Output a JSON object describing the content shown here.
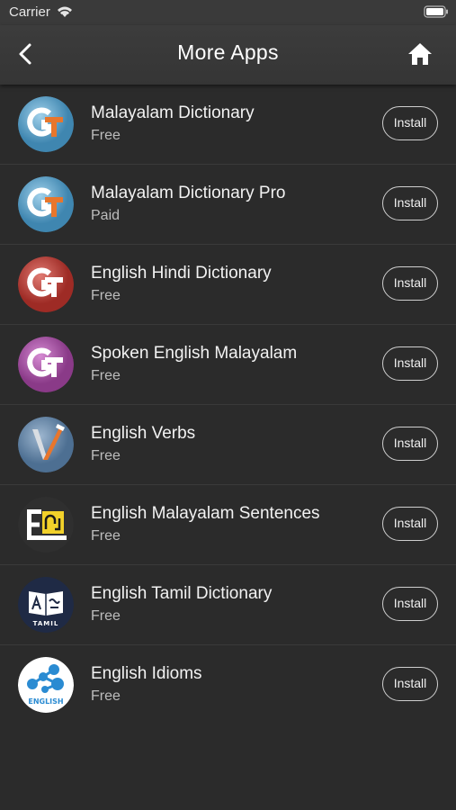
{
  "status_bar": {
    "carrier": "Carrier",
    "icons": [
      "wifi-icon",
      "battery-icon"
    ]
  },
  "nav": {
    "title": "More Apps",
    "back_icon": "chevron-left-icon",
    "home_icon": "home-icon"
  },
  "apps": [
    {
      "name": "Malayalam Dictionary",
      "price": "Free",
      "install_label": "Install",
      "icon": "gt-logo-blue"
    },
    {
      "name": "Malayalam Dictionary Pro",
      "price": "Paid",
      "install_label": "Install",
      "icon": "gt-logo-blue"
    },
    {
      "name": "English Hindi Dictionary",
      "price": "Free",
      "install_label": "Install",
      "icon": "gt-logo-red"
    },
    {
      "name": "Spoken English Malayalam",
      "price": "Free",
      "install_label": "Install",
      "icon": "gt-logo-purple"
    },
    {
      "name": "English Verbs",
      "price": "Free",
      "install_label": "Install",
      "icon": "verbs-logo"
    },
    {
      "name": "English Malayalam Sentences",
      "price": "Free",
      "install_label": "Install",
      "icon": "sentences-logo"
    },
    {
      "name": "English Tamil Dictionary",
      "price": "Free",
      "install_label": "Install",
      "icon": "tamil-dictionary-logo"
    },
    {
      "name": "English Idioms",
      "price": "Free",
      "install_label": "Install",
      "icon": "idioms-logo"
    }
  ],
  "tamil_icon_text": "TAMIL",
  "idioms_icon_text": "ENGLISH",
  "colors": {
    "background": "#2b2b2b",
    "navbar": "#383838",
    "text": "#ffffff",
    "subtext": "#bdbdbd"
  }
}
